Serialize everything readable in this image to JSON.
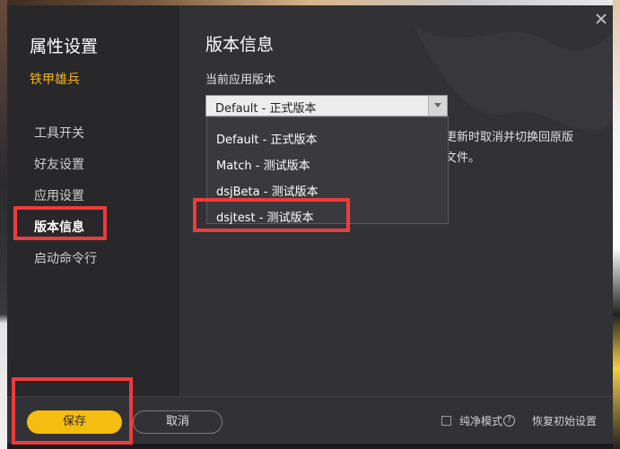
{
  "sidebar": {
    "title": "属性设置",
    "game_name": "铁甲雄兵",
    "items": [
      {
        "label": "工具开关"
      },
      {
        "label": "好友设置"
      },
      {
        "label": "应用设置"
      },
      {
        "label": "版本信息"
      },
      {
        "label": "启动命令行"
      }
    ],
    "active_index": 3
  },
  "main": {
    "title": "版本信息",
    "field_label": "当前应用版本",
    "select_value": "Default - 正式版本",
    "description": "更新时取消并切换回原版\n文件。",
    "dropdown_options": [
      "Default - 正式版本",
      "Match - 测试版本",
      "dsjBeta - 测试版本",
      "dsjtest - 测试版本"
    ]
  },
  "footer": {
    "save_label": "保存",
    "cancel_label": "取消",
    "pure_mode_label": "纯净模式",
    "help_glyph": "?",
    "restore_label": "恢复初始设置"
  },
  "colors": {
    "accent": "#f5bd10",
    "highlight": "#ef3b3b",
    "panel": "#323236",
    "sidebar": "#28282b"
  }
}
